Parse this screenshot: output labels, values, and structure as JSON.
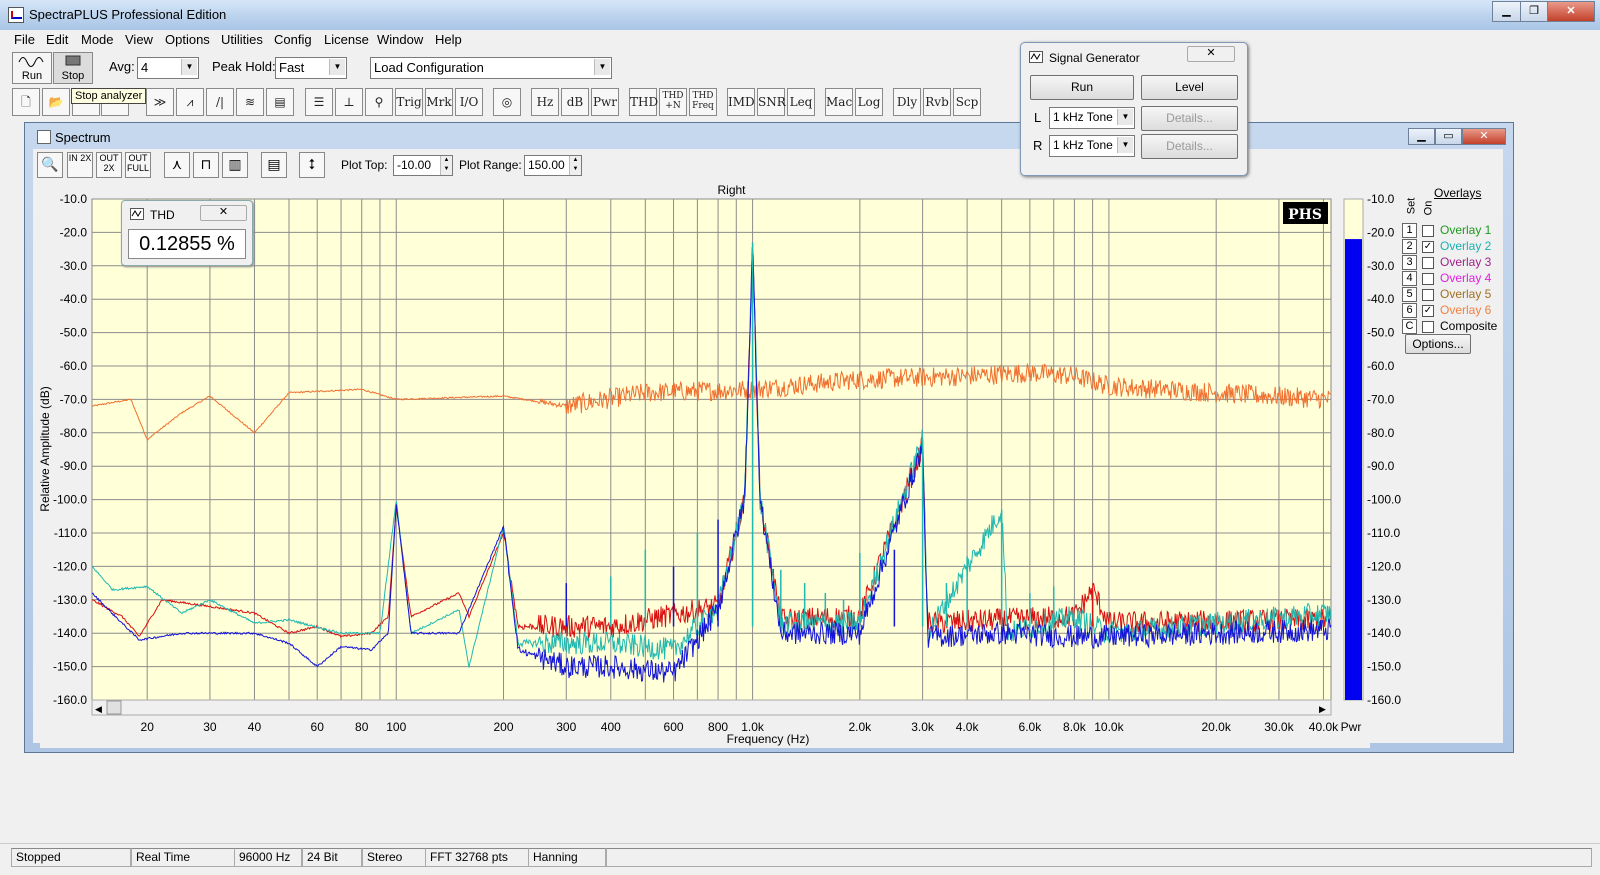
{
  "window": {
    "title": "SpectraPLUS Professional Edition"
  },
  "menu": [
    "File",
    "Edit",
    "Mode",
    "View",
    "Options",
    "Utilities",
    "Config",
    "License",
    "Window",
    "Help"
  ],
  "toolbar": {
    "run_label": "Run",
    "stop_label": "Stop",
    "avg_label": "Avg:",
    "avg_value": "4",
    "peak_hold_label": "Peak Hold:",
    "peak_hold_value": "Fast",
    "config_value": "Load Configuration",
    "tooltip": "Stop analyzer",
    "buttons": [
      "Trig",
      "Mrk",
      "I/O",
      "Hz",
      "dB",
      "Pwr",
      "THD",
      "THD +N",
      "THD Freq",
      "IMD",
      "SNR",
      "Leq",
      "Mac",
      "Log",
      "Dly",
      "Rvb",
      "Scp"
    ]
  },
  "spectrum": {
    "title": "Spectrum",
    "zoom_buttons": [
      "IN 2X",
      "OUT 2X",
      "OUT FULL"
    ],
    "plot_top_label": "Plot Top:",
    "plot_top_value": "-10.00",
    "plot_range_label": "Plot Range:",
    "plot_range_value": "150.00",
    "channel": "Right",
    "badge": "PHS"
  },
  "thd": {
    "title": "THD",
    "value": "0.12855 %"
  },
  "overlays": {
    "heading": "Overlays",
    "set_label": "Set",
    "on_label": "On",
    "items": [
      {
        "num": "1",
        "label": "Overlay 1",
        "color": "#1e9a1e",
        "checked": false
      },
      {
        "num": "2",
        "label": "Overlay 2",
        "color": "#1ab0b0",
        "checked": true
      },
      {
        "num": "3",
        "label": "Overlay 3",
        "color": "#a0208c",
        "checked": false
      },
      {
        "num": "4",
        "label": "Overlay 4",
        "color": "#e020e0",
        "checked": false
      },
      {
        "num": "5",
        "label": "Overlay 5",
        "color": "#a07020",
        "checked": false
      },
      {
        "num": "6",
        "label": "Overlay 6",
        "color": "#f08040",
        "checked": true
      },
      {
        "num": "C",
        "label": "Composite",
        "color": "#000000",
        "checked": false
      }
    ],
    "options_label": "Options..."
  },
  "signal_generator": {
    "title": "Signal Generator",
    "run_label": "Run",
    "level_label": "Level",
    "left_label": "L",
    "right_label": "R",
    "left_value": "1 kHz Tone",
    "right_value": "1 kHz Tone",
    "details_label": "Details..."
  },
  "status": [
    "Stopped",
    "Real Time",
    "96000 Hz",
    "24 Bit",
    "Stereo",
    "FFT 32768 pts",
    "Hanning"
  ],
  "chart_data": {
    "type": "line",
    "title": "Right",
    "xlabel": "Frequency (Hz)",
    "ylabel": "Relative Amplitude (dB)",
    "x_scale": "log",
    "xlim": [
      14,
      42000
    ],
    "ylim": [
      -160,
      -10
    ],
    "y_ticks": [
      -10,
      -20,
      -30,
      -40,
      -50,
      -60,
      -70,
      -80,
      -90,
      -100,
      -110,
      -120,
      -130,
      -140,
      -150,
      -160
    ],
    "x_tick_labels": [
      {
        "x": 20,
        "label": "20"
      },
      {
        "x": 30,
        "label": "30"
      },
      {
        "x": 40,
        "label": "40"
      },
      {
        "x": 60,
        "label": "60"
      },
      {
        "x": 80,
        "label": "80"
      },
      {
        "x": 100,
        "label": "100"
      },
      {
        "x": 200,
        "label": "200"
      },
      {
        "x": 300,
        "label": "300"
      },
      {
        "x": 400,
        "label": "400"
      },
      {
        "x": 600,
        "label": "600"
      },
      {
        "x": 800,
        "label": "800"
      },
      {
        "x": 1000,
        "label": "1.0k"
      },
      {
        "x": 2000,
        "label": "2.0k"
      },
      {
        "x": 3000,
        "label": "3.0k"
      },
      {
        "x": 4000,
        "label": "4.0k"
      },
      {
        "x": 6000,
        "label": "6.0k"
      },
      {
        "x": 8000,
        "label": "8.0k"
      },
      {
        "x": 10000,
        "label": "10.0k"
      },
      {
        "x": 20000,
        "label": "20.0k"
      },
      {
        "x": 30000,
        "label": "30.0k"
      },
      {
        "x": 40000,
        "label": "40.0k"
      }
    ],
    "right_axis_label": "Pwr",
    "power_bar_value": -22,
    "grid": true,
    "background": "#ffffd8",
    "series": [
      {
        "color": "#f07030",
        "points": [
          [
            14,
            -72
          ],
          [
            18,
            -70
          ],
          [
            20,
            -82
          ],
          [
            25,
            -74
          ],
          [
            30,
            -69
          ],
          [
            40,
            -80
          ],
          [
            50,
            -68
          ],
          [
            80,
            -67
          ],
          [
            100,
            -70
          ],
          [
            200,
            -69
          ],
          [
            300,
            -72
          ],
          [
            500,
            -68
          ],
          [
            1000,
            -67
          ],
          [
            2000,
            -64
          ],
          [
            4000,
            -63
          ],
          [
            6000,
            -62
          ],
          [
            8000,
            -63
          ],
          [
            10000,
            -66
          ],
          [
            20000,
            -68
          ],
          [
            42000,
            -70
          ]
        ]
      },
      {
        "color": "#d81010",
        "points": [
          [
            14,
            -130
          ],
          [
            17,
            -135
          ],
          [
            19,
            -141
          ],
          [
            22,
            -130
          ],
          [
            30,
            -132
          ],
          [
            40,
            -134
          ],
          [
            50,
            -140
          ],
          [
            60,
            -138
          ],
          [
            70,
            -141
          ],
          [
            85,
            -140
          ],
          [
            95,
            -135
          ],
          [
            100,
            -102
          ],
          [
            110,
            -135
          ],
          [
            150,
            -128
          ],
          [
            160,
            -135
          ],
          [
            200,
            -110
          ],
          [
            220,
            -138
          ],
          [
            400,
            -138
          ],
          [
            800,
            -132
          ],
          [
            950,
            -100
          ],
          [
            1000,
            -24
          ],
          [
            1050,
            -100
          ],
          [
            1200,
            -136
          ],
          [
            2000,
            -135
          ],
          [
            3000,
            -84
          ],
          [
            3100,
            -137
          ],
          [
            5000,
            -136
          ],
          [
            8000,
            -135
          ],
          [
            9000,
            -127
          ],
          [
            10000,
            -137
          ],
          [
            42000,
            -136
          ]
        ]
      },
      {
        "color": "#20b8b0",
        "points": [
          [
            14,
            -120
          ],
          [
            16,
            -127
          ],
          [
            20,
            -126
          ],
          [
            25,
            -134
          ],
          [
            30,
            -130
          ],
          [
            40,
            -137
          ],
          [
            50,
            -136
          ],
          [
            70,
            -140
          ],
          [
            90,
            -140
          ],
          [
            100,
            -100
          ],
          [
            110,
            -140
          ],
          [
            150,
            -133
          ],
          [
            160,
            -150
          ],
          [
            200,
            -108
          ],
          [
            220,
            -143
          ],
          [
            400,
            -143
          ],
          [
            600,
            -145
          ],
          [
            800,
            -132
          ],
          [
            950,
            -100
          ],
          [
            1000,
            -23
          ],
          [
            1050,
            -100
          ],
          [
            1200,
            -137
          ],
          [
            2000,
            -137
          ],
          [
            3000,
            -82
          ],
          [
            3100,
            -140
          ],
          [
            5000,
            -103
          ],
          [
            5200,
            -140
          ],
          [
            8000,
            -135
          ],
          [
            10000,
            -140
          ],
          [
            42000,
            -134
          ]
        ]
      },
      {
        "color": "#1414d8",
        "points": [
          [
            14,
            -128
          ],
          [
            17,
            -137
          ],
          [
            19,
            -142
          ],
          [
            25,
            -140
          ],
          [
            30,
            -140
          ],
          [
            40,
            -140
          ],
          [
            50,
            -143
          ],
          [
            60,
            -150
          ],
          [
            70,
            -144
          ],
          [
            85,
            -145
          ],
          [
            95,
            -140
          ],
          [
            100,
            -101
          ],
          [
            110,
            -140
          ],
          [
            150,
            -140
          ],
          [
            200,
            -108
          ],
          [
            220,
            -145
          ],
          [
            300,
            -150
          ],
          [
            400,
            -150
          ],
          [
            600,
            -152
          ],
          [
            800,
            -133
          ],
          [
            950,
            -100
          ],
          [
            1000,
            -24
          ],
          [
            1050,
            -100
          ],
          [
            1200,
            -140
          ],
          [
            2000,
            -140
          ],
          [
            3000,
            -84
          ],
          [
            3100,
            -141
          ],
          [
            5000,
            -140
          ],
          [
            8000,
            -141
          ],
          [
            10000,
            -141
          ],
          [
            42000,
            -139
          ]
        ]
      }
    ],
    "spikes": [
      {
        "x": 1000,
        "y": -23,
        "color": "#20b8b0"
      },
      {
        "x": 2000,
        "y": -116,
        "color": "#20b8b0"
      },
      {
        "x": 2500,
        "y": -115,
        "color": "#1414d8"
      },
      {
        "x": 3000,
        "y": -82,
        "color": "#20b8b0"
      },
      {
        "x": 3500,
        "y": -125,
        "color": "#20b8b0"
      },
      {
        "x": 4000,
        "y": -117,
        "color": "#20b8b0"
      },
      {
        "x": 5000,
        "y": -103,
        "color": "#20b8b0"
      },
      {
        "x": 6000,
        "y": -128,
        "color": "#20b8b0"
      },
      {
        "x": 7000,
        "y": -126,
        "color": "#20b8b0"
      },
      {
        "x": 9000,
        "y": -127,
        "color": "#d81010"
      },
      {
        "x": 800,
        "y": -106,
        "color": "#1414d8"
      },
      {
        "x": 700,
        "y": -110,
        "color": "#20b8b0"
      },
      {
        "x": 600,
        "y": -120,
        "color": "#1414d8"
      },
      {
        "x": 500,
        "y": -115,
        "color": "#20b8b0"
      },
      {
        "x": 400,
        "y": -123,
        "color": "#20b8b0"
      },
      {
        "x": 300,
        "y": -125,
        "color": "#1414d8"
      },
      {
        "x": 1200,
        "y": -121,
        "color": "#20b8b0"
      },
      {
        "x": 1400,
        "y": -125,
        "color": "#20b8b0"
      },
      {
        "x": 1600,
        "y": -128,
        "color": "#20b8b0"
      },
      {
        "x": 1800,
        "y": -130,
        "color": "#20b8b0"
      }
    ]
  }
}
